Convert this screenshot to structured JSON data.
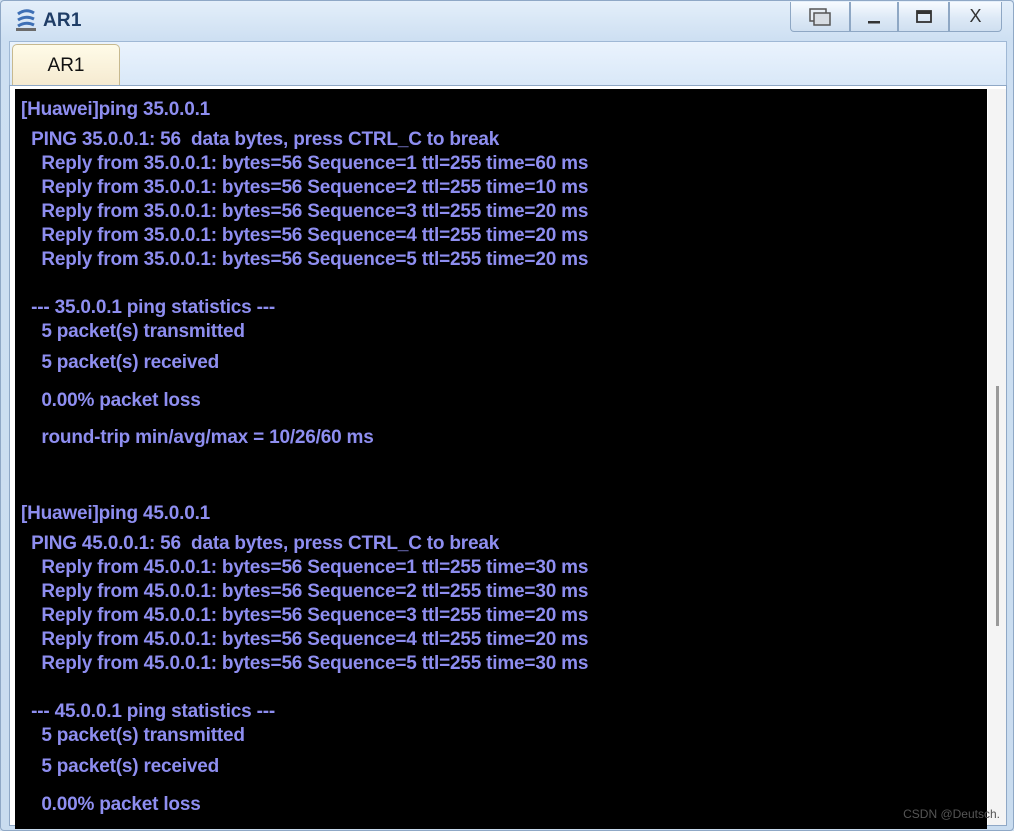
{
  "window": {
    "title": "AR1",
    "tab_label": "AR1",
    "close_label": "X"
  },
  "terminal": {
    "text_color": "#8e8ef0",
    "background": "#000000",
    "lines": [
      "[Huawei]ping 35.0.0.1",
      "  PING 35.0.0.1: 56  data bytes, press CTRL_C to break",
      "    Reply from 35.0.0.1: bytes=56 Sequence=1 ttl=255 time=60 ms",
      "    Reply from 35.0.0.1: bytes=56 Sequence=2 ttl=255 time=10 ms",
      "    Reply from 35.0.0.1: bytes=56 Sequence=3 ttl=255 time=20 ms",
      "    Reply from 35.0.0.1: bytes=56 Sequence=4 ttl=255 time=20 ms",
      "    Reply from 35.0.0.1: bytes=56 Sequence=5 ttl=255 time=20 ms",
      "  --- 35.0.0.1 ping statistics ---",
      "    5 packet(s) transmitted",
      "    5 packet(s) received",
      "    0.00% packet loss",
      "    round-trip min/avg/max = 10/26/60 ms",
      "[Huawei]ping 45.0.0.1",
      "  PING 45.0.0.1: 56  data bytes, press CTRL_C to break",
      "    Reply from 45.0.0.1: bytes=56 Sequence=1 ttl=255 time=30 ms",
      "    Reply from 45.0.0.1: bytes=56 Sequence=2 ttl=255 time=30 ms",
      "    Reply from 45.0.0.1: bytes=56 Sequence=3 ttl=255 time=20 ms",
      "    Reply from 45.0.0.1: bytes=56 Sequence=4 ttl=255 time=20 ms",
      "    Reply from 45.0.0.1: bytes=56 Sequence=5 ttl=255 time=30 ms",
      "  --- 45.0.0.1 ping statistics ---",
      "    5 packet(s) transmitted",
      "    5 packet(s) received",
      "    0.00% packet loss"
    ]
  },
  "watermark": "CSDN @Deutsch."
}
